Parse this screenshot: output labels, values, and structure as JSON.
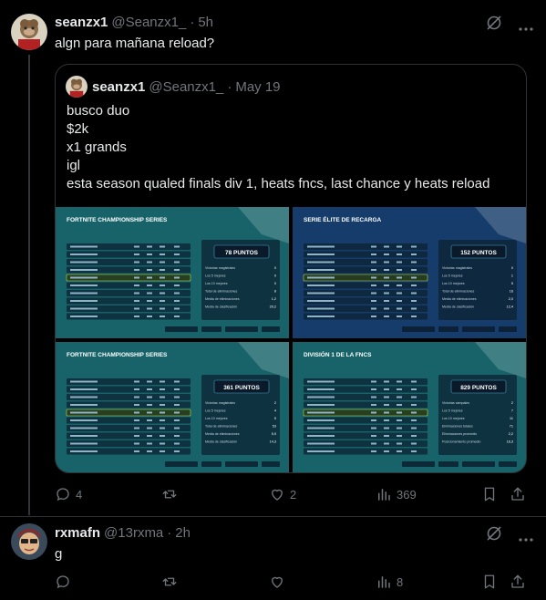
{
  "post": {
    "author_name": "seanzx1",
    "author_handle": "@Seanzx1_",
    "separator": "·",
    "time": "5h",
    "text": "algn para mañana reload?",
    "quote": {
      "author_name": "seanzx1",
      "author_handle": "@Seanzx1_",
      "separator": "·",
      "time": "May 19",
      "lines": [
        "busco duo",
        "$2k",
        "x1 grands",
        "igl",
        "esta season qualed finals div 1, heats fncs, last chance y heats reload"
      ],
      "images": [
        {
          "title": "FORTNITE CHAMPIONSHIP SERIES",
          "points_label": "78 PUNTOS",
          "theme": "#1f8a8a",
          "stats": [
            {
              "label": "Victorias magistrales",
              "value": "0"
            },
            {
              "label": "Los 5 mejores",
              "value": "0"
            },
            {
              "label": "Los 10 mejores",
              "value": "0"
            },
            {
              "label": "Total de eliminaciones",
              "value": "8"
            },
            {
              "label": "Media de eliminaciones",
              "value": "1,2"
            },
            {
              "label": "Media de clasificación",
              "value": "20,2"
            }
          ]
        },
        {
          "title": "SERIE ÉLITE DE RECARGA",
          "points_label": "152 PUNTOS",
          "theme": "#1d4f8c",
          "stats": [
            {
              "label": "Victorias magistrales",
              "value": "0"
            },
            {
              "label": "Los 5 mejores",
              "value": "1"
            },
            {
              "label": "Los 10 mejores",
              "value": "5"
            },
            {
              "label": "Total de eliminaciones",
              "value": "16"
            },
            {
              "label": "Media de eliminaciones",
              "value": "2,0"
            },
            {
              "label": "Media de clasificación",
              "value": "12,4"
            }
          ]
        },
        {
          "title": "FORTNITE CHAMPIONSHIP SERIES",
          "points_label": "361 PUNTOS",
          "theme": "#1f8a8a",
          "stats": [
            {
              "label": "Victorias magistrales",
              "value": "2"
            },
            {
              "label": "Los 5 mejores",
              "value": "4"
            },
            {
              "label": "Los 10 mejores",
              "value": "5"
            },
            {
              "label": "Total de eliminaciones",
              "value": "53"
            },
            {
              "label": "Media de eliminaciones",
              "value": "5,9"
            },
            {
              "label": "Media de clasificación",
              "value": "14,3"
            }
          ]
        },
        {
          "title": "DIVISIÓN 1 DE LA FNCS",
          "points_label": "829 PUNTOS",
          "theme": "#1f8a8a",
          "stats": [
            {
              "label": "Victorias campales",
              "value": "2"
            },
            {
              "label": "Los 5 mejores",
              "value": "7"
            },
            {
              "label": "Los 10 mejores",
              "value": "11"
            },
            {
              "label": "Eliminaciones totales",
              "value": "71"
            },
            {
              "label": "Eliminaciones promedio",
              "value": "2,2"
            },
            {
              "label": "Posicionamiento promedio",
              "value": "16,3"
            }
          ]
        }
      ]
    },
    "actions": {
      "replies": "4",
      "reposts": "",
      "likes": "2",
      "views": "369"
    }
  },
  "reply": {
    "author_name": "rxmafn",
    "author_handle": "@13rxma",
    "separator": "·",
    "time": "2h",
    "text": "g",
    "actions": {
      "replies": "",
      "reposts": "",
      "likes": "",
      "views": "8"
    }
  },
  "colors": {
    "background": "#000000",
    "text": "#e7e9ea",
    "muted": "#71767b",
    "border": "#2f3336"
  }
}
